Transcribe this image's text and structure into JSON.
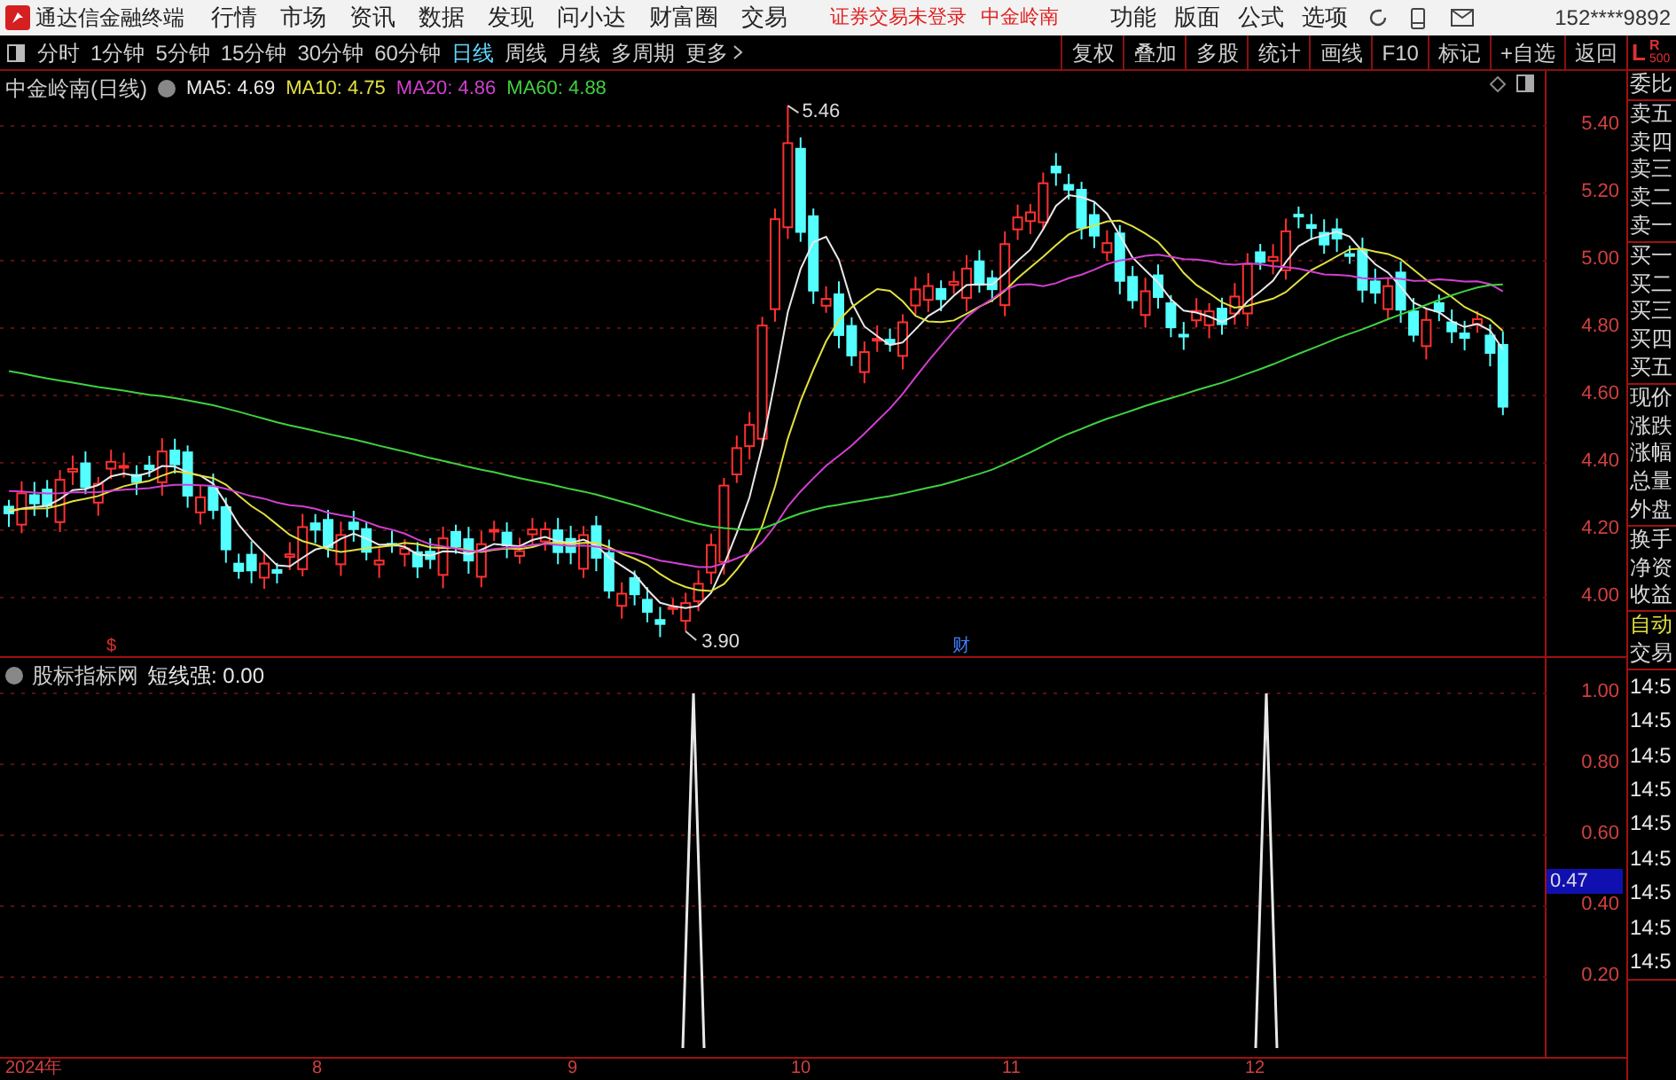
{
  "app": {
    "title": "通达信金融终端",
    "menu": [
      "行情",
      "市场",
      "资讯",
      "数据",
      "发现",
      "问小达",
      "财富圈",
      "交易"
    ],
    "login_status": "证券交易未登录",
    "stock_name": "中金岭南",
    "tools": [
      "功能",
      "版面",
      "公式",
      "选项"
    ],
    "account": "152****9892"
  },
  "period_tabs": [
    {
      "label": "分时",
      "selected": false
    },
    {
      "label": "1分钟",
      "selected": false
    },
    {
      "label": "5分钟",
      "selected": false
    },
    {
      "label": "15分钟",
      "selected": false
    },
    {
      "label": "30分钟",
      "selected": false
    },
    {
      "label": "60分钟",
      "selected": false
    },
    {
      "label": "日线",
      "selected": true
    },
    {
      "label": "周线",
      "selected": false
    },
    {
      "label": "月线",
      "selected": false
    },
    {
      "label": "多周期",
      "selected": false
    },
    {
      "label": "更多",
      "selected": false
    }
  ],
  "chart_tools": [
    "复权",
    "叠加",
    "多股",
    "统计",
    "画线",
    "F10",
    "标记",
    "+自选",
    "返回"
  ],
  "main_chart": {
    "title": "中金岭南(日线)",
    "indicators": [
      {
        "label": "MA5: 4.69",
        "color": "#e8e8e8"
      },
      {
        "label": "MA10: 4.75",
        "color": "#e0e040"
      },
      {
        "label": "MA20: 4.86",
        "color": "#d040d0"
      },
      {
        "label": "MA60: 4.88",
        "color": "#40d040"
      }
    ],
    "yticks": [
      "5.40",
      "5.20",
      "5.00",
      "4.80",
      "4.60",
      "4.40",
      "4.20",
      "4.00"
    ],
    "high_label": "5.46",
    "low_label": "3.90",
    "markers": [
      {
        "text": "$",
        "color": "#e03030"
      },
      {
        "text": "财",
        "color": "#4080ff"
      }
    ]
  },
  "sub_chart": {
    "title": "股标指标网",
    "reading": "短线强: 0.00",
    "yticks": [
      "1.00",
      "0.80",
      "0.60",
      "0.40",
      "0.20"
    ],
    "cursor_value": "0.47"
  },
  "x_axis": [
    "2024年",
    "8",
    "9",
    "10",
    "11",
    "12"
  ],
  "quote_panel": {
    "corner_left": "L",
    "corner_right": "R",
    "corner_sub": "500",
    "groups": [
      [
        {
          "label": "委比",
          "kind": "plain"
        }
      ],
      [
        {
          "label": "卖五",
          "kind": "plain"
        },
        {
          "label": "卖四",
          "kind": "plain"
        },
        {
          "label": "卖三",
          "kind": "plain"
        },
        {
          "label": "卖二",
          "kind": "plain"
        },
        {
          "label": "卖一",
          "kind": "plain"
        }
      ],
      [
        {
          "label": "买一",
          "kind": "plain"
        },
        {
          "label": "买二",
          "kind": "plain"
        },
        {
          "label": "买三",
          "kind": "plain"
        },
        {
          "label": "买四",
          "kind": "plain"
        },
        {
          "label": "买五",
          "kind": "plain"
        }
      ],
      [
        {
          "label": "现价",
          "kind": "plain"
        },
        {
          "label": "涨跌",
          "kind": "plain"
        },
        {
          "label": "涨幅",
          "kind": "plain"
        },
        {
          "label": "总量",
          "kind": "plain"
        },
        {
          "label": "外盘",
          "kind": "plain"
        }
      ],
      [
        {
          "label": "换手",
          "kind": "plain"
        },
        {
          "label": "净资",
          "kind": "plain"
        },
        {
          "label": "收益",
          "kind": "plain"
        }
      ],
      [
        {
          "label": "自动",
          "kind": "accent"
        },
        {
          "label": "交易",
          "kind": "plain"
        }
      ],
      [
        {
          "label": "14:5",
          "kind": "time"
        },
        {
          "label": "14:5",
          "kind": "time"
        },
        {
          "label": "14:5",
          "kind": "time"
        },
        {
          "label": "14:5",
          "kind": "time"
        },
        {
          "label": "14:5",
          "kind": "time"
        },
        {
          "label": "14:5",
          "kind": "time"
        },
        {
          "label": "14:5",
          "kind": "time"
        },
        {
          "label": "14:5",
          "kind": "time"
        },
        {
          "label": "14:5",
          "kind": "time"
        }
      ]
    ]
  }
}
